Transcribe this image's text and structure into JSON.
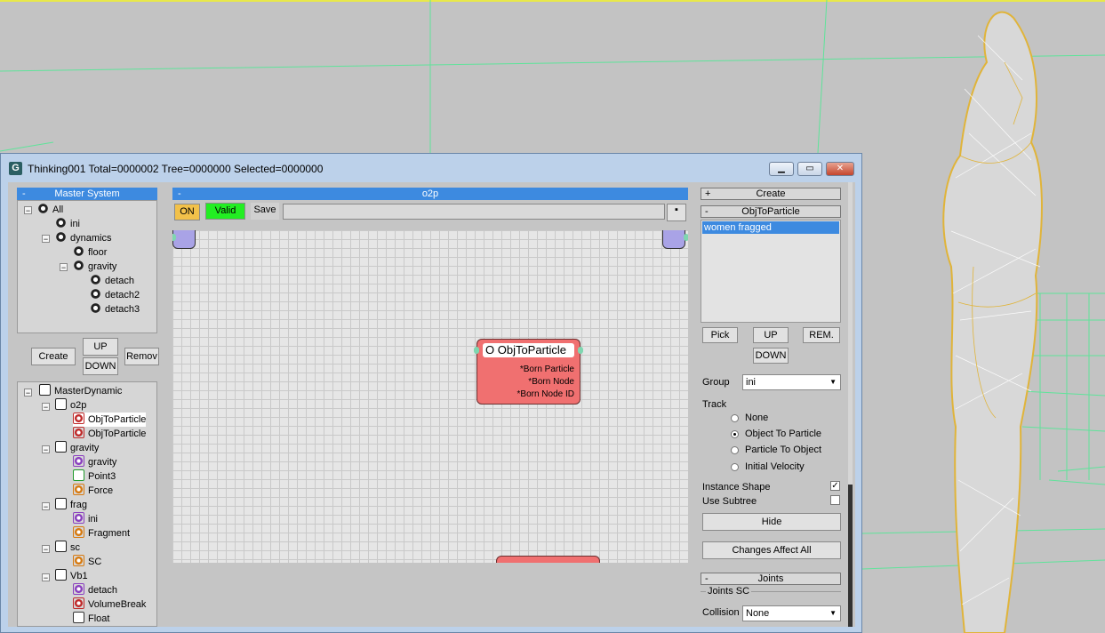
{
  "window": {
    "title": "Thinking001  Total=0000002  Tree=0000000  Selected=0000000",
    "icon": "G"
  },
  "master_panel": {
    "header": "Master System",
    "minus": "-"
  },
  "master_tree": [
    {
      "label": "All"
    },
    {
      "label": "ini"
    },
    {
      "label": "dynamics"
    },
    {
      "label": "floor"
    },
    {
      "label": "gravity"
    },
    {
      "label": "detach"
    },
    {
      "label": "detach2"
    },
    {
      "label": "detach3"
    }
  ],
  "master_buttons": {
    "create": "Create",
    "up": "UP",
    "down": "DOWN",
    "remove": "Remov"
  },
  "dyn_tree": [
    {
      "label": "MasterDynamic"
    },
    {
      "label": "o2p"
    },
    {
      "label": "ObjToParticle"
    },
    {
      "label": "ObjToParticle"
    },
    {
      "label": "gravity"
    },
    {
      "label": "gravity"
    },
    {
      "label": "Point3"
    },
    {
      "label": "Force"
    },
    {
      "label": "frag"
    },
    {
      "label": "ini"
    },
    {
      "label": "Fragment"
    },
    {
      "label": "sc"
    },
    {
      "label": "SC"
    },
    {
      "label": "Vb1"
    },
    {
      "label": "detach"
    },
    {
      "label": "VolumeBreak"
    },
    {
      "label": "Float"
    }
  ],
  "graph_panel": {
    "header": "o2p",
    "minus": "-",
    "on": "ON",
    "valid": "Valid",
    "save": "Save"
  },
  "node": {
    "title": "O ObjToParticle",
    "outputs": [
      "*Born Particle",
      "*Born Node",
      "*Born Node ID"
    ]
  },
  "right": {
    "create_rollout": "Create",
    "plus": "+",
    "minus": "-",
    "objto_rollout": "ObjToParticle",
    "list_item": "women fragged",
    "pick": "Pick",
    "up": "UP",
    "rem": "REM.",
    "down": "DOWN",
    "group_label": "Group",
    "group_value": "ini",
    "track_label": "Track",
    "track_options": [
      "None",
      "Object To Particle",
      "Particle To Object",
      "Initial Velocity"
    ],
    "track_selected": 1,
    "instance_shape": "Instance Shape",
    "instance_checked": "✓",
    "use_subtree": "Use Subtree",
    "hide": "Hide",
    "changes": "Changes Affect All",
    "joints_rollout": "Joints",
    "joints_sc": "Joints SC",
    "collision_label": "Collision",
    "collision_value": "None"
  },
  "colors": {
    "accent": "#3d8ae0",
    "on": "#f2c14a",
    "valid": "#22ee22",
    "node": "#f07070",
    "grid_green": "#52e08a"
  }
}
